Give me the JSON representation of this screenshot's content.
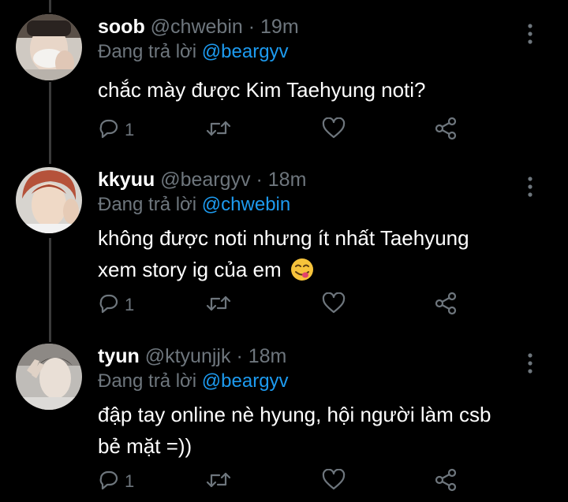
{
  "tweets": [
    {
      "name": "soob",
      "handle": "@chwebin",
      "separator": "·",
      "time": "19m",
      "reply_prefix": "Đang trả lời",
      "reply_to": "@beargyv",
      "text_lines": [
        "chắc mày được Kim Taehyung noti?"
      ],
      "reply_count": "1"
    },
    {
      "name": "kkyuu",
      "handle": "@beargyv",
      "separator": "·",
      "time": "18m",
      "reply_prefix": "Đang trả lời",
      "reply_to": "@chwebin",
      "text_lines": [
        "không được noti nhưng ít nhất Taehyung",
        "xem story ig của em"
      ],
      "reply_count": "1"
    },
    {
      "name": "tyun",
      "handle": "@ktyunjjk",
      "separator": "·",
      "time": "18m",
      "reply_prefix": "Đang trả lời",
      "reply_to": "@beargyv",
      "text_lines": [
        "đập tay online nè hyung, hội người làm csb",
        "bẻ mặt =))"
      ],
      "reply_count": "1"
    }
  ],
  "icons": {
    "reply": "reply-icon",
    "retweet": "retweet-icon",
    "like": "heart-icon",
    "share": "share-icon",
    "more": "more-options-icon",
    "emoji": "face-savoring-food-emoji"
  },
  "colors": {
    "background": "#000000",
    "text": "#ffffff",
    "muted": "#6e767d",
    "mention": "#1d9bf0",
    "thread_line": "#3a3a3a"
  }
}
